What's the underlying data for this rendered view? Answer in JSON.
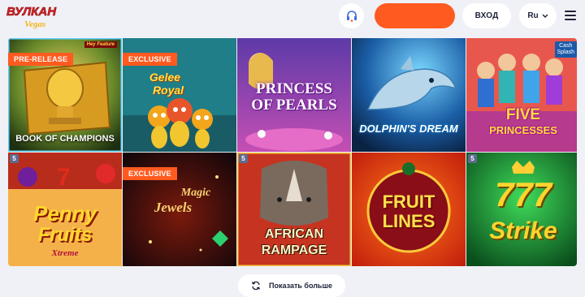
{
  "header": {
    "logo_main": "ВУЛКАН",
    "logo_sub": "Vegas",
    "login_label": "ВХОД",
    "lang_label": "Ru",
    "promo_color": "#ff5a1f"
  },
  "games": [
    {
      "title": "BOOK OF CHAMPIONS",
      "badge": "PRE-RELEASE",
      "tag": "Hey Feature"
    },
    {
      "title_line1": "Gelee",
      "title_line2": "Royal",
      "badge": "EXCLUSIVE"
    },
    {
      "title_line1": "PRINCESS",
      "title_line2": "OF PEARLS"
    },
    {
      "title": "DOLPHIN'S DREAM"
    },
    {
      "title_line1": "FIVE",
      "title_line2": "PRINCESSES",
      "tag_line1": "Cash",
      "tag_line2": "Splash"
    },
    {
      "title_line1": "Penny",
      "title_line2": "Fruits",
      "title_line3": "Xtreme",
      "provider": "5"
    },
    {
      "title_line1": "Magic",
      "title_line2": "Jewels",
      "badge": "EXCLUSIVE"
    },
    {
      "title_line1": "AFRICAN",
      "title_line2": "RAMPAGE",
      "provider": "5"
    },
    {
      "title_line1": "FRUIT",
      "title_line2": "LINES"
    },
    {
      "title_line1": "777",
      "title_line2": "Strike",
      "provider": "5"
    }
  ],
  "show_more_label": "Показать больше",
  "icons": {
    "support": "headset-icon",
    "menu": "hamburger-menu-icon",
    "lang_chevron": "chevron-down-icon",
    "refresh": "refresh-icon"
  }
}
